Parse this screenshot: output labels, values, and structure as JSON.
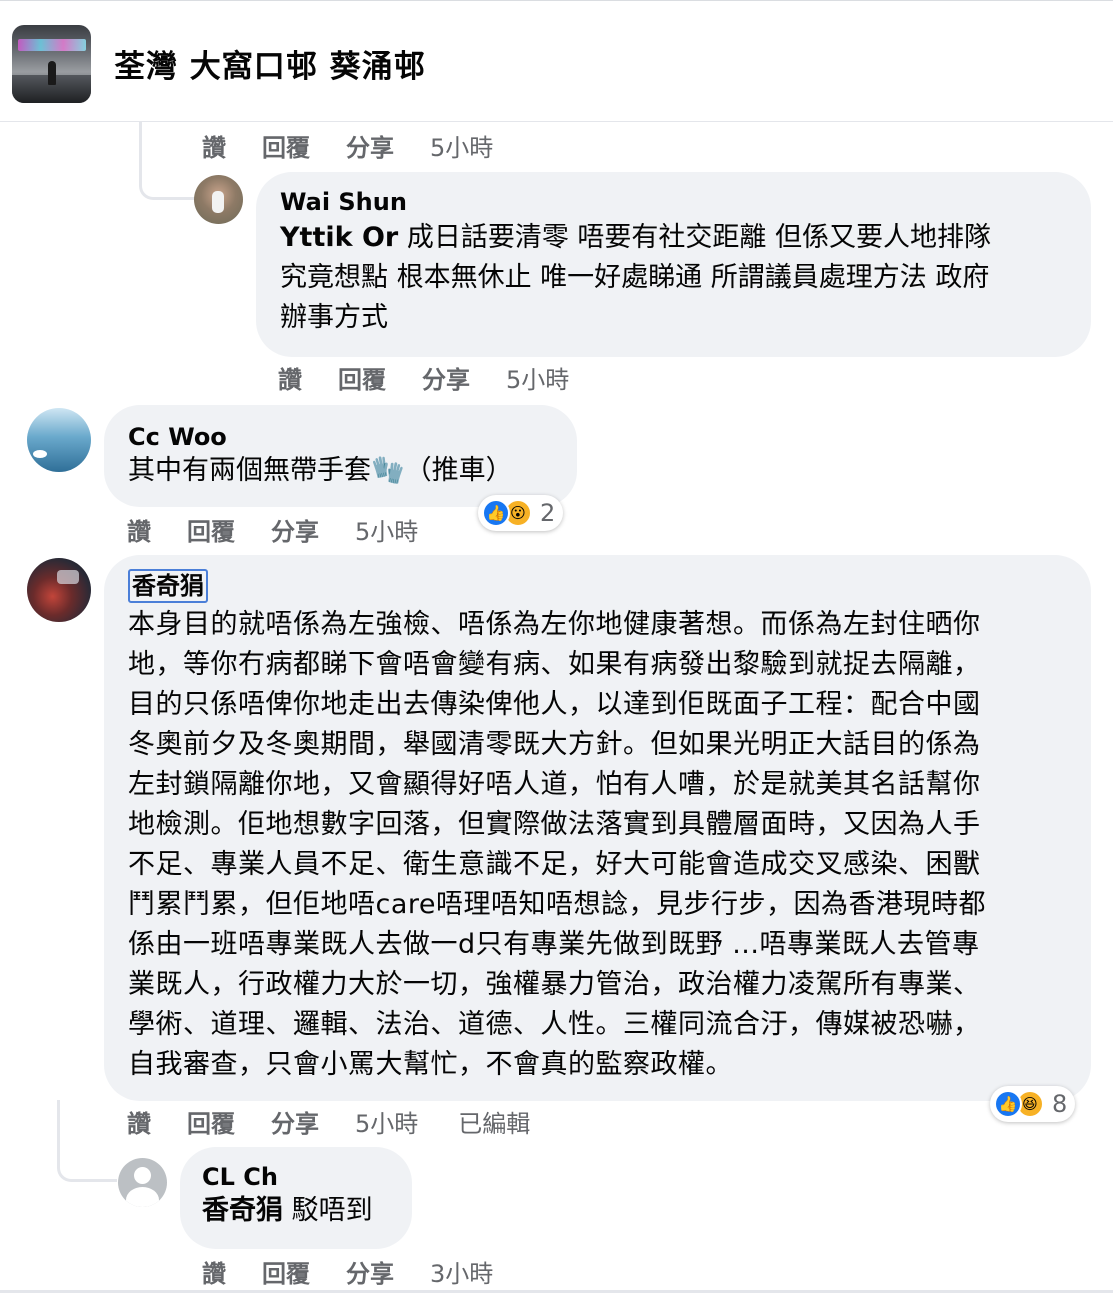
{
  "group": {
    "title": "荃灣 大窩口邨 葵涌邨",
    "avatar_icon": "group-cover-photo"
  },
  "actions": {
    "like": "讚",
    "reply": "回覆",
    "share": "分享"
  },
  "comments": {
    "top_meta": {
      "time": "5小時"
    },
    "wai_shun": {
      "author": "Wai Shun",
      "mention": "Yttik Or",
      "line1": "成日話要清零 唔要有社交距離 但係又要人地排隊",
      "line2": "究竟想點 根本無休止 唯一好處睇通 所謂議員處理方法 政府",
      "line3": "辦事方式",
      "time": "5小時"
    },
    "cc_woo": {
      "author": "Cc Woo",
      "text_before": "其中有兩個無帶手套",
      "emoji": "🧤",
      "text_after": "（推車）",
      "reaction_count": "2",
      "time": "5小時"
    },
    "heung_kei": {
      "author": "香奇狷",
      "lines": [
        "本身目的就唔係為左強檢、唔係為左你地健康著想。而係為左封住晒你",
        "地，等你冇病都睇下會唔會變有病、如果有病發出黎驗到就捉去隔離，",
        "目的只係唔俾你地走出去傳染俾他人，以達到佢既面子工程：配合中國",
        "冬奧前夕及冬奧期間，舉國清零既大方針。但如果光明正大話目的係為",
        "左封鎖隔離你地，又會顯得好唔人道，怕有人嘈，於是就美其名話幫你",
        "地檢測。佢地想數字回落，但實際做法落實到具體層面時，又因為人手",
        "不足、專業人員不足、衛生意識不足，好大可能會造成交叉感染、困獸",
        "鬥累鬥累，但佢地唔care唔理唔知唔想諗，見步行步，因為香港現時都",
        "係由一班唔專業既人去做一d只有專業先做到既野 ...唔專業既人去管專",
        "業既人，行政權力大於一切，強權暴力管治，政治權力凌駕所有專業、",
        "學術、道理、邏輯、法治、道德、人性。三權同流合汙，傳媒被恐嚇，",
        "自我審查，只會小罵大幫忙，不會真的監察政權。"
      ],
      "reaction_count": "8",
      "time": "5小時",
      "edited": "已編輯"
    },
    "cl_ch": {
      "author": "CL Ch",
      "mention": "香奇狷",
      "text": "駁唔到",
      "time": "3小時"
    }
  }
}
